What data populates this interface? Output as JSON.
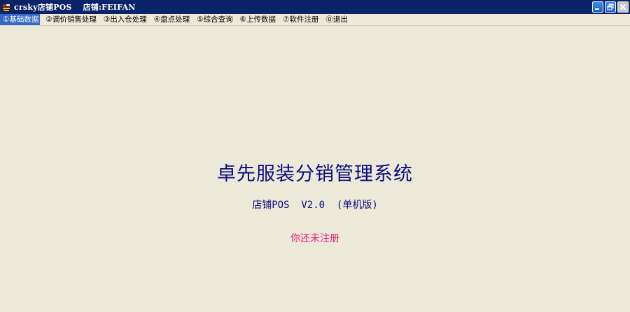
{
  "titlebar": {
    "app_title": "crsky店铺POS",
    "store": "店铺:FEIFAN"
  },
  "menu": {
    "items": [
      {
        "label": "①基础数据",
        "active": true
      },
      {
        "label": "②调价销售处理"
      },
      {
        "label": "③出入仓处理"
      },
      {
        "label": "④盘点处理"
      },
      {
        "label": "⑤综合查询"
      },
      {
        "label": "⑥上传数据"
      },
      {
        "label": "⑦软件注册"
      },
      {
        "label": "⓪退出"
      }
    ]
  },
  "main": {
    "system_title": "卓先服装分销管理系统",
    "version_line": "店铺POS  V2.0  (单机版)",
    "registration_notice": "你还未注册"
  },
  "colors": {
    "titlebar": "#0A246A",
    "menu_active": "#316AC5",
    "background": "#ECE9D8",
    "title_text": "#0A0A80",
    "notice_text": "#E0207F"
  },
  "icons": {
    "app": "app-icon",
    "minimize": "minimize-icon",
    "maximize": "restore-icon",
    "close": "close-icon"
  }
}
